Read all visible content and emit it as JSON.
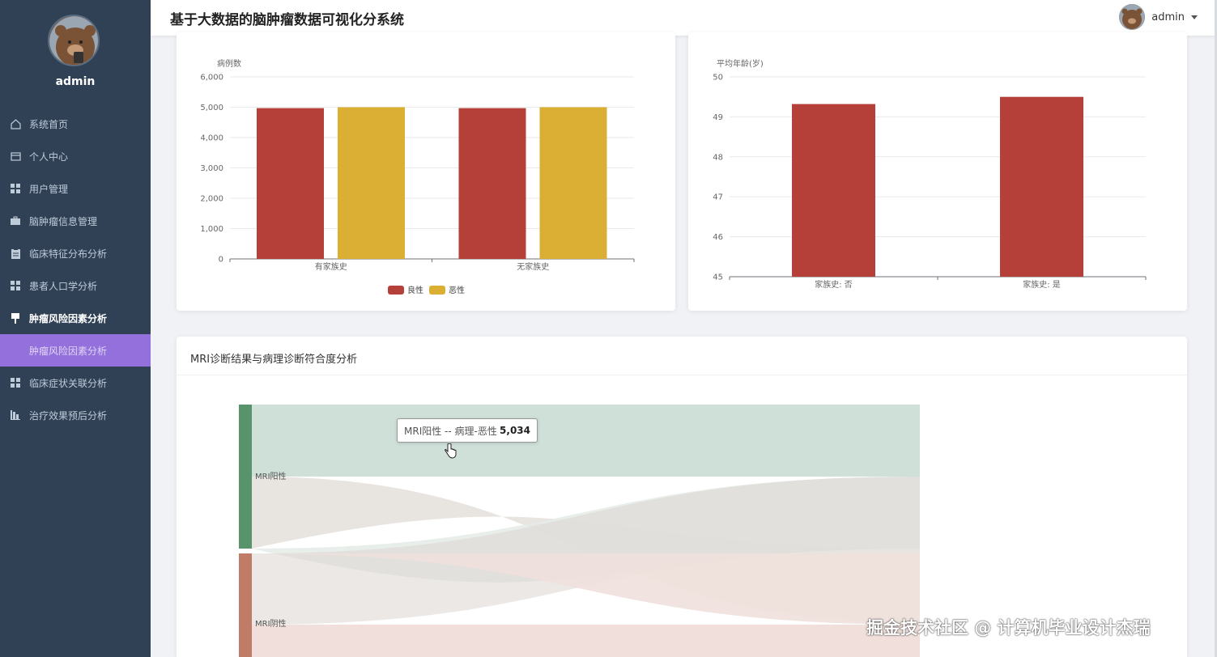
{
  "app": {
    "title": "基于大数据的脑肿瘤数据可视化分系统"
  },
  "user": {
    "name": "admin"
  },
  "sidebar": {
    "username": "admin",
    "items": [
      {
        "label": "系统首页",
        "icon": "home-icon"
      },
      {
        "label": "个人中心",
        "icon": "profile-icon"
      },
      {
        "label": "用户管理",
        "icon": "grid-icon"
      },
      {
        "label": "脑肿瘤信息管理",
        "icon": "briefcase-icon"
      },
      {
        "label": "临床特征分布分析",
        "icon": "clipboard-icon"
      },
      {
        "label": "患者人口学分析",
        "icon": "grid-icon"
      },
      {
        "label": "肿瘤风险因素分析",
        "icon": "pin-icon",
        "active": true
      },
      {
        "label": "临床症状关联分析",
        "icon": "grid-icon"
      },
      {
        "label": "治疗效果预后分析",
        "icon": "bar-chart-icon"
      }
    ],
    "active_sub_item": "肿瘤风险因素分析"
  },
  "colors": {
    "red": "#b5403a",
    "gold": "#dbae34",
    "green": "#57946c",
    "brown": "#c07c66",
    "active_menu": "#9370db",
    "sidebar_bg": "#304156"
  },
  "chart_data": [
    {
      "type": "bar",
      "ylabel": "病例数",
      "categories": [
        "有家族史",
        "无家族史"
      ],
      "yticks": [
        "0",
        "1,000",
        "2,000",
        "3,000",
        "4,000",
        "5,000",
        "6,000"
      ],
      "ylim": [
        0,
        6000
      ],
      "series": [
        {
          "name": "良性",
          "color": "#b5403a",
          "values": [
            4970,
            4970
          ]
        },
        {
          "name": "恶性",
          "color": "#dbae34",
          "values": [
            5000,
            5000
          ]
        }
      ],
      "legend": "bottom-center"
    },
    {
      "type": "bar",
      "ylabel": "平均年龄(岁)",
      "categories": [
        "家族史: 否",
        "家族史: 是"
      ],
      "yticks": [
        "45",
        "46",
        "47",
        "48",
        "49",
        "50"
      ],
      "ylim": [
        45,
        50
      ],
      "series": [
        {
          "color": "#b5403a",
          "values": [
            49.32,
            49.5
          ]
        }
      ]
    },
    {
      "type": "sankey",
      "title": "MRI诊断结果与病理诊断符合度分析",
      "nodes": [
        "MRI阳性",
        "MRI阴性"
      ],
      "links": [
        {
          "source": "MRI阳性",
          "target": "病理-恶性",
          "value": 5034
        }
      ],
      "tooltip": {
        "label": "MRI阳性 -- 病理-恶性",
        "value": "5,034"
      }
    }
  ],
  "watermark": "掘金技术社区 @ 计算机毕业设计杰瑞"
}
